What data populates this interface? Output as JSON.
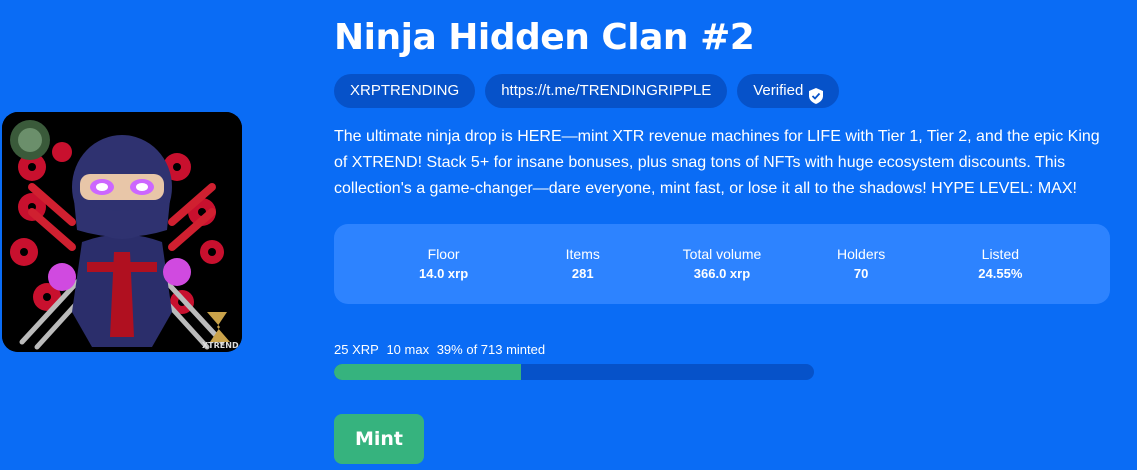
{
  "collection": {
    "title": "Ninja Hidden Clan #2",
    "description": "The ultimate ninja drop is HERE—mint XTR revenue machines for LIFE with Tier 1, Tier 2, and the epic King of XTREND! Stack 5+ for insane bonuses, plus snag tons of NFTs with huge ecosystem discounts. This collection's a game-changer—dare everyone, mint fast, or lose it all to the shadows! HYPE LEVEL: MAX!"
  },
  "art": {
    "logo_text": "XTREND",
    "logo_icon": "xtrend-logo-icon"
  },
  "chips": [
    {
      "label": "XRPTRENDING"
    },
    {
      "label": "https://t.me/TRENDINGRIPPLE"
    },
    {
      "label": "Verified",
      "icon": "shield-check-icon"
    }
  ],
  "stats": [
    {
      "label": "Floor",
      "value": "14.0 xrp"
    },
    {
      "label": "Items",
      "value": "281"
    },
    {
      "label": "Total volume",
      "value": "366.0 xrp"
    },
    {
      "label": "Holders",
      "value": "70"
    },
    {
      "label": "Listed",
      "value": "24.55%"
    }
  ],
  "mint": {
    "price": "25 XRP",
    "max": "10 max",
    "progress_text": "39% of 713 minted",
    "progress_fraction": 0.39,
    "button_label": "Mint"
  },
  "colors": {
    "background": "#0a6cf5",
    "chip": "#0652c9",
    "stats_panel": "#2d83ff",
    "accent_green": "#36b37e"
  }
}
